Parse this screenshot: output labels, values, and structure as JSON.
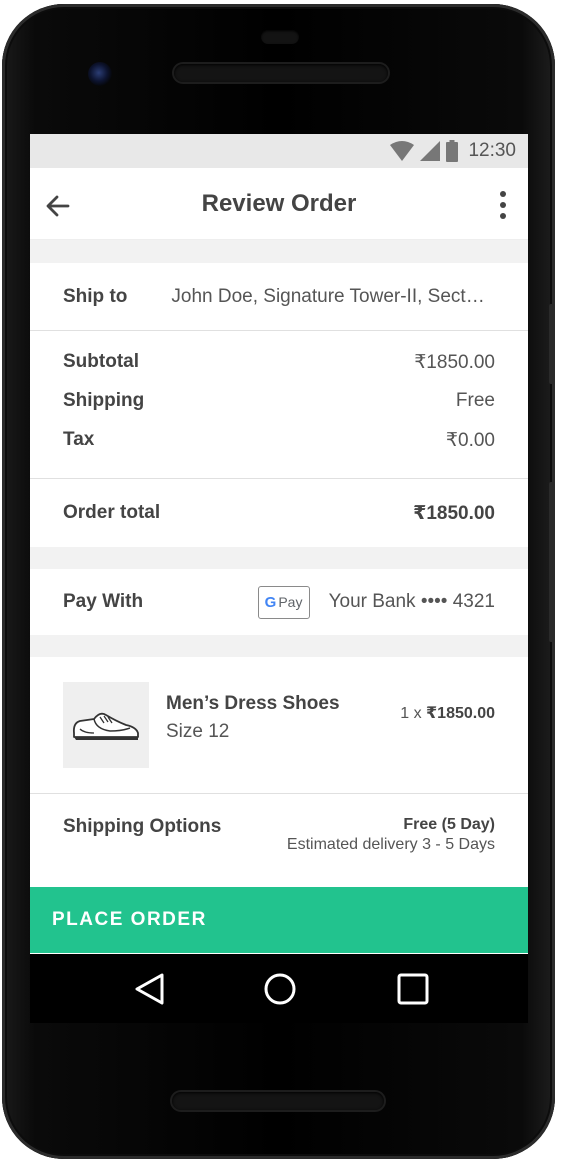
{
  "status_bar": {
    "time": "12:30"
  },
  "app_bar": {
    "title": "Review Order"
  },
  "ship_to": {
    "label": "Ship to",
    "address": "John Doe, Signature Tower-II, Sect…"
  },
  "totals": [
    {
      "label": "Subtotal",
      "value": "₹1850.00"
    },
    {
      "label": "Shipping",
      "value": "Free"
    },
    {
      "label": "Tax",
      "value": "₹0.00"
    }
  ],
  "order_total": {
    "label": "Order total",
    "value": "₹1850.00"
  },
  "pay_with": {
    "label": "Pay With",
    "gpay_g": "G",
    "gpay_text": "Pay",
    "account": "Your Bank •••• 4321"
  },
  "item": {
    "name": "Men’s Dress Shoes",
    "size": "Size 12",
    "qty": "1 x",
    "price": "₹1850.00"
  },
  "shipping_options": {
    "label": "Shipping Options",
    "option": "Free (5 Day)",
    "estimate": "Estimated delivery 3 - 5 Days"
  },
  "place_order": {
    "label": "PLACE ORDER"
  },
  "colors": {
    "accent": "#22c38e",
    "gap": "#f2f2f2",
    "status_bar": "#e8e8e8"
  }
}
